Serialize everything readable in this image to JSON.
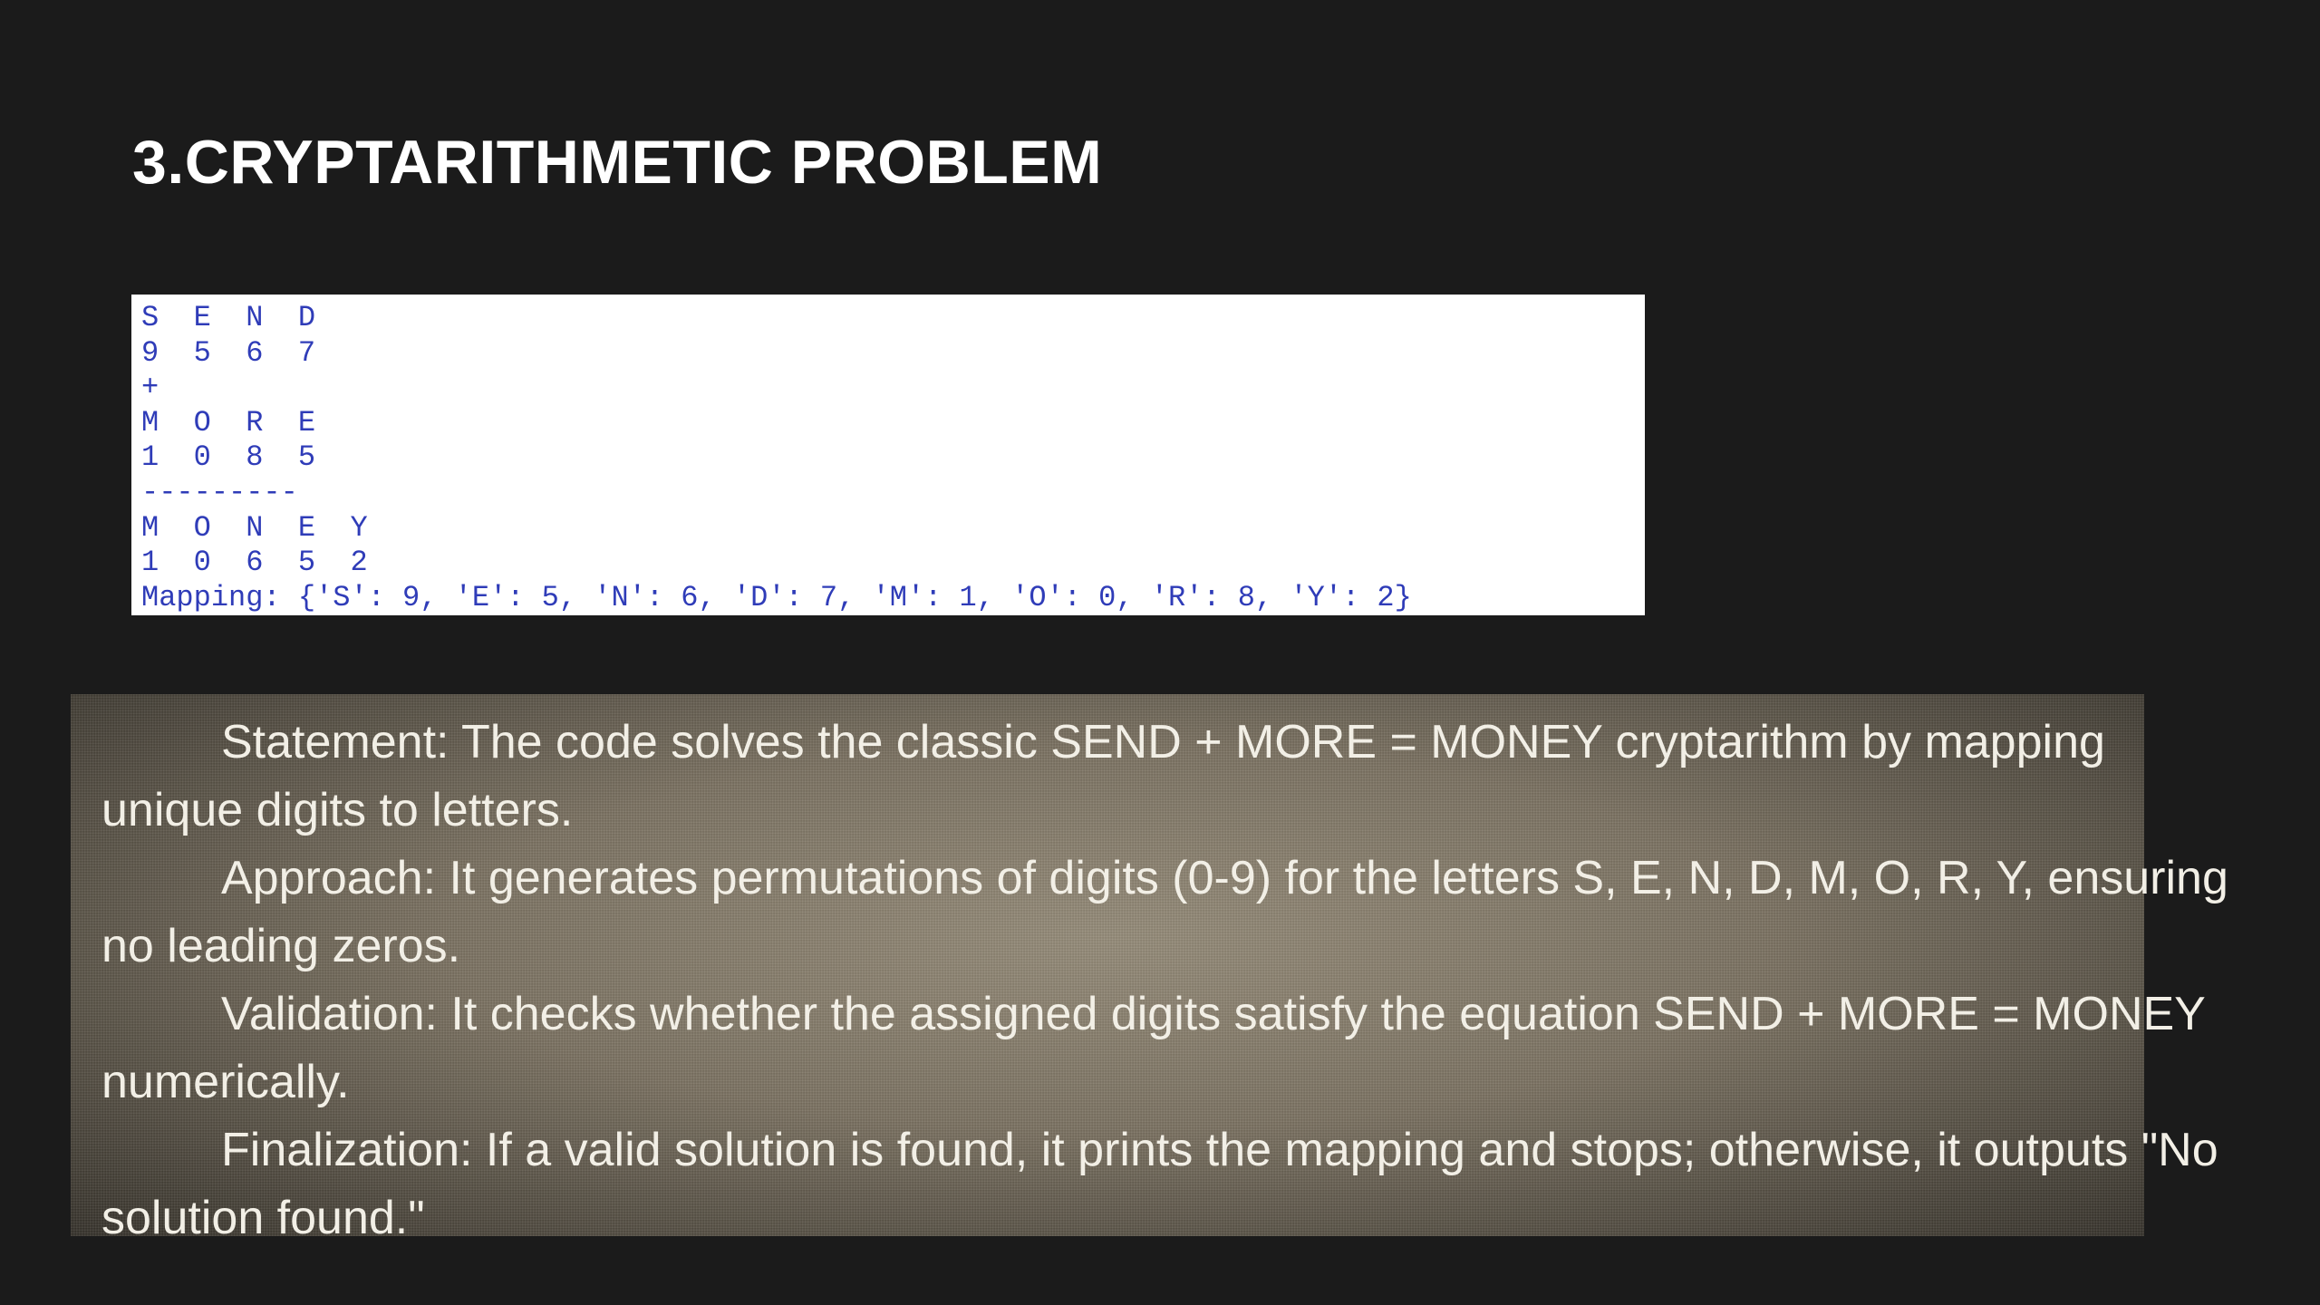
{
  "title": "3.CRYPTARITHMETIC PROBLEM",
  "code_output": {
    "lines": [
      "S  E  N  D",
      "9  5  6  7",
      "+",
      "M  O  R  E",
      "1  0  8  5",
      "---------",
      "M  O  N  E  Y",
      "1  0  6  5  2",
      "Mapping: {'S': 9, 'E': 5, 'N': 6, 'D': 7, 'M': 1, 'O': 0, 'R': 8, 'Y': 2}"
    ]
  },
  "description": {
    "paragraphs": [
      "Statement: The code solves the classic SEND + MORE = MONEY cryptarithm by mapping unique digits to letters.",
      "Approach: It generates permutations of digits (0-9) for the letters S, E, N, D, M, O, R, Y, ensuring no leading zeros.",
      "Validation: It checks whether the assigned digits satisfy the equation SEND + MORE = MONEY numerically.",
      "Finalization: If a valid solution is found, it prints the mapping and stops; otherwise, it outputs \"No solution found.\""
    ]
  }
}
